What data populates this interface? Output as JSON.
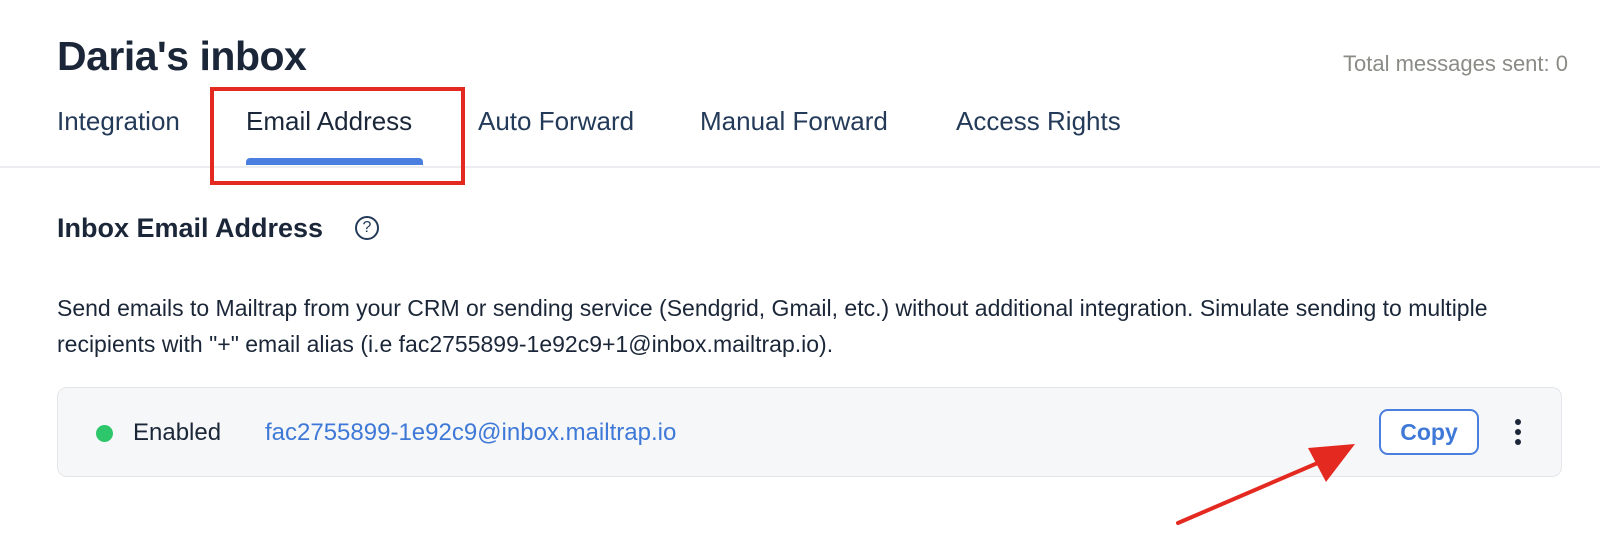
{
  "header": {
    "title": "Daria's inbox",
    "total_sent": "Total messages sent: 0"
  },
  "tabs": [
    {
      "label": "Integration",
      "active": false
    },
    {
      "label": "Email Address",
      "active": true
    },
    {
      "label": "Auto Forward",
      "active": false
    },
    {
      "label": "Manual Forward",
      "active": false
    },
    {
      "label": "Access Rights",
      "active": false
    }
  ],
  "section": {
    "title": "Inbox Email Address",
    "help_icon": "question-circle-icon",
    "description": "Send emails to Mailtrap from your CRM or sending service (Sendgrid, Gmail, etc.) without additional integration. Simulate sending to multiple recipients with \"+\" email alias (i.e fac2755899-1e92c9+1@inbox.mailtrap.io)."
  },
  "address": {
    "status": "Enabled",
    "status_color": "#2ec66b",
    "email": "fac2755899-1e92c9@inbox.mailtrap.io",
    "copy_label": "Copy",
    "more_icon": "vertical-ellipsis-icon"
  },
  "colors": {
    "accent": "#4a7fe0",
    "annotation": "#e42a20"
  }
}
